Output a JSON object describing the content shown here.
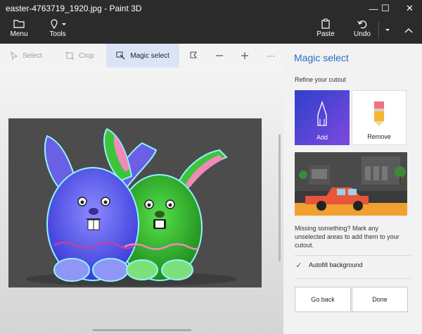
{
  "window": {
    "title": "easter-4763719_1920.jpg - Paint 3D",
    "minimize": "—",
    "maximize": "☐",
    "close": "✕"
  },
  "ribbon": {
    "menu_label": "Menu",
    "tools_label": "Tools",
    "paste_label": "Paste",
    "undo_label": "Undo"
  },
  "toolbar": {
    "select_label": "Select",
    "crop_label": "Crop",
    "magic_select_label": "Magic select",
    "more_label": "···"
  },
  "panel": {
    "title": "Magic select",
    "subtitle": "Refine your cutout",
    "add_label": "Add",
    "remove_label": "Remove",
    "help_text": "Missing something? Mark any unselected areas to add them to your cutout.",
    "autofill_label": "Autofill background",
    "go_back_label": "Go back",
    "done_label": "Done"
  },
  "colors": {
    "accent": "#1f6fc2",
    "titlebar": "#2b2b2b",
    "add_card_gradient": [
      "#2f3fc9",
      "#7d4ae0"
    ]
  }
}
